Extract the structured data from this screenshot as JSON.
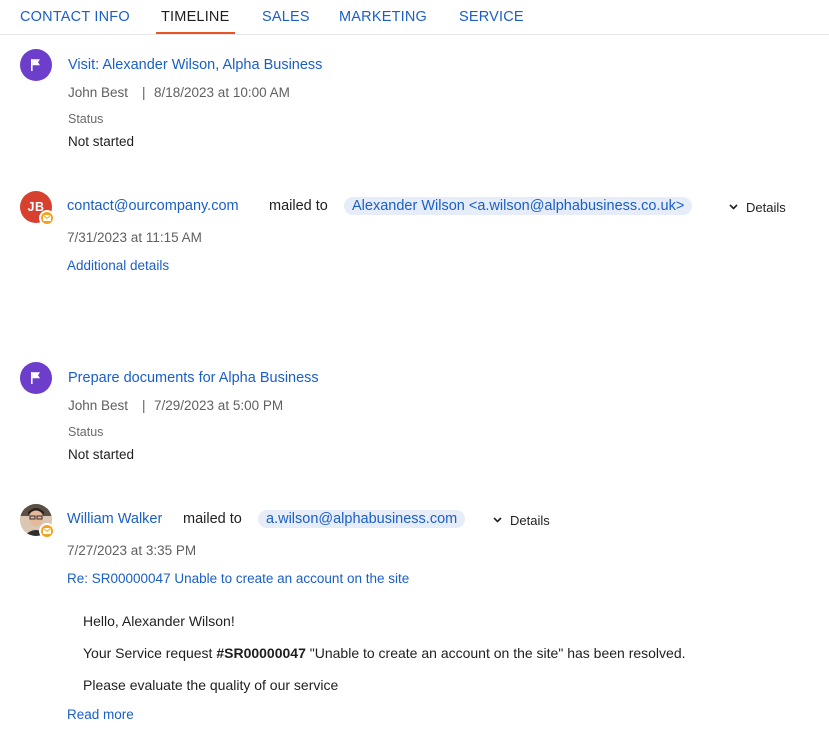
{
  "tabs": [
    {
      "label": "CONTACT INFO",
      "active": false
    },
    {
      "label": "TIMELINE",
      "active": true
    },
    {
      "label": "SALES",
      "active": false
    },
    {
      "label": "MARKETING",
      "active": false
    },
    {
      "label": "SERVICE",
      "active": false
    }
  ],
  "accent_color": "#e65527",
  "link_color": "#1a5fc7",
  "timeline": {
    "item1": {
      "icon": "flag-icon",
      "title": "Visit: Alexander Wilson, Alpha Business",
      "owner": "John Best",
      "separator": "|",
      "datetime": "8/18/2023 at 10:00 AM",
      "status_label": "Status",
      "status_value": "Not started"
    },
    "item2": {
      "avatar_initials": "JB",
      "badge_icon": "mail-icon",
      "sender": "contact@ourcompany.com",
      "verb": "mailed to",
      "recipient": "Alexander Wilson <a.wilson@alphabusiness.co.uk>",
      "details_label": "Details",
      "datetime": "7/31/2023 at 11:15 AM",
      "additional_label": "Additional details"
    },
    "item3": {
      "icon": "flag-icon",
      "title": "Prepare documents for Alpha Business",
      "owner": "John Best",
      "separator": "|",
      "datetime": "7/29/2023 at 5:00 PM",
      "status_label": "Status",
      "status_value": "Not started"
    },
    "item4": {
      "badge_icon": "mail-icon",
      "sender": "William Walker",
      "verb": "mailed to",
      "recipient": "a.wilson@alphabusiness.com",
      "details_label": "Details",
      "datetime": "7/27/2023 at 3:35 PM",
      "subject": "Re: SR00000047 Unable to create an account on the site",
      "greeting": "Hello, Alexander Wilson!",
      "line2_prefix": "Your Service request ",
      "line2_code": "#SR00000047",
      "line2_suffix": " \"Unable to create an account on the site\" has been resolved.",
      "line3": "Please evaluate the quality of our service",
      "read_more": "Read more"
    }
  }
}
